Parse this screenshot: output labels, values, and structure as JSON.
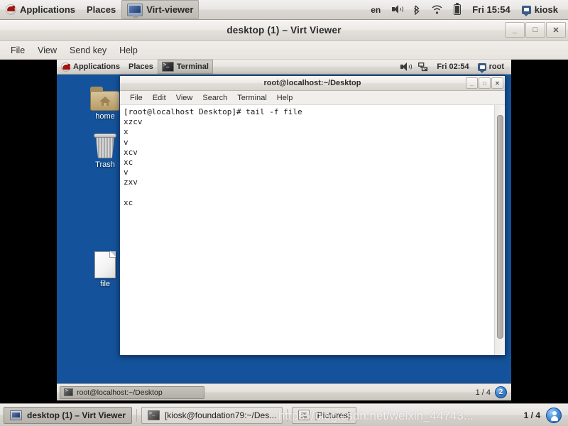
{
  "host_panel": {
    "menus": [
      {
        "label": "Applications",
        "icon": "redhat-logo-icon"
      },
      {
        "label": "Places",
        "icon": null
      }
    ],
    "window_button": {
      "label": "Virt-viewer",
      "icon": "monitor-icon"
    },
    "tray": {
      "keyboard_layout": "en",
      "icons": [
        "speaker-icon",
        "bluetooth-icon",
        "wifi-icon",
        "battery-icon"
      ],
      "clock": "Fri 15:54",
      "user": "kiosk",
      "user_icon": "user-icon"
    }
  },
  "virt_viewer": {
    "title": "desktop (1) – Virt Viewer",
    "menu": [
      "File",
      "View",
      "Send key",
      "Help"
    ],
    "window_controls": {
      "minimize": "_",
      "maximize": "□",
      "close": "✕"
    }
  },
  "vm": {
    "panel": {
      "menus": [
        {
          "label": "Applications",
          "icon": "redhat-logo-icon"
        },
        {
          "label": "Places",
          "icon": null
        }
      ],
      "window_button": {
        "label": "Terminal",
        "icon": "terminal-icon"
      },
      "tray": {
        "icons": [
          "speaker-icon",
          "network-disconnected-icon"
        ],
        "clock": "Fri 02:54",
        "user": "root",
        "user_icon": "user-icon"
      }
    },
    "desktop_icons": [
      {
        "label": "home",
        "icon": "home-folder-icon"
      },
      {
        "label": "Trash",
        "icon": "trash-icon"
      },
      {
        "label": "file",
        "icon": "document-icon"
      }
    ],
    "terminal": {
      "title": "root@localhost:~/Desktop",
      "menu": [
        "File",
        "Edit",
        "View",
        "Search",
        "Terminal",
        "Help"
      ],
      "window_controls": {
        "minimize": "_",
        "maximize": "□",
        "close": "✕"
      },
      "content": "[root@localhost Desktop]# tail -f file\nxzcv\nx\nv\nxcv\nxc\nv\nzxv\n\nxc"
    },
    "taskbar": {
      "tasks": [
        {
          "label": "root@localhost:~/Desktop",
          "icon": "terminal-icon",
          "active": true
        }
      ],
      "workspace": "1 / 4",
      "badge": "2"
    }
  },
  "host_taskbar": {
    "tasks": [
      {
        "label": "desktop (1) – Virt Viewer",
        "icon": "monitor-icon",
        "active": true
      },
      {
        "label": "[kiosk@foundation79:~/Des...",
        "icon": "terminal-icon",
        "active": false
      },
      {
        "label": "[Pictures]",
        "icon": "file-manager-icon",
        "active": false
      }
    ],
    "workspace": "1 / 4",
    "badge_icon": "user-badge-icon"
  },
  "watermark": "https://blog.csdn.net/weixin_44743...",
  "colors": {
    "vm_desktop_blue": "#14539b",
    "panel_grey": "#e5e2de",
    "terminal_bg": "#ffffff",
    "terminal_fg": "#1c1c1c",
    "accent_blue": "#1f5fae"
  }
}
